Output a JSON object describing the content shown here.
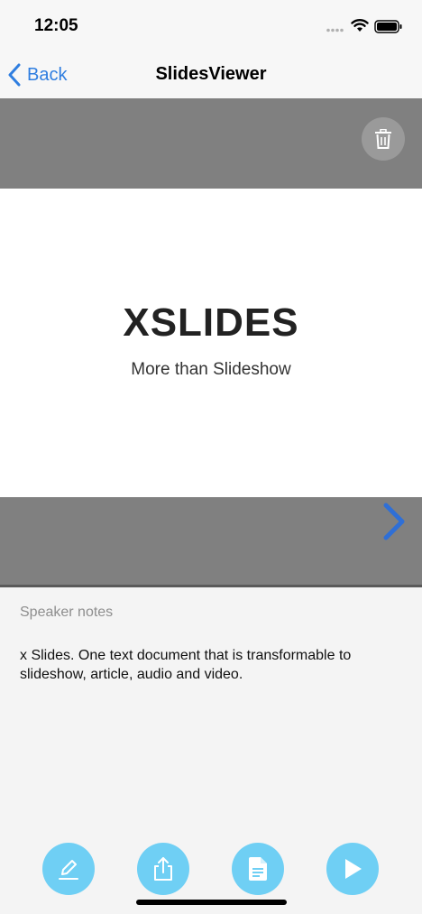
{
  "status_bar": {
    "time": "12:05",
    "icons": [
      "signal-dots-icon",
      "wifi-icon",
      "battery-icon"
    ]
  },
  "nav": {
    "back_label": "Back",
    "title": "SlidesViewer",
    "accent_color": "#2f7ee0"
  },
  "slide": {
    "title": "XSLIDES",
    "subtitle": "More than Slideshow",
    "delete_icon": "trash-icon",
    "next_icon": "chevron-right-icon"
  },
  "notes": {
    "label": "Speaker notes",
    "text": "x Slides. One text document that is transformable to slideshow, article, audio and video."
  },
  "toolbar": {
    "button_color": "#6fcff4",
    "buttons": [
      {
        "icon": "pencil-icon"
      },
      {
        "icon": "share-icon"
      },
      {
        "icon": "document-icon"
      },
      {
        "icon": "play-icon"
      }
    ]
  }
}
